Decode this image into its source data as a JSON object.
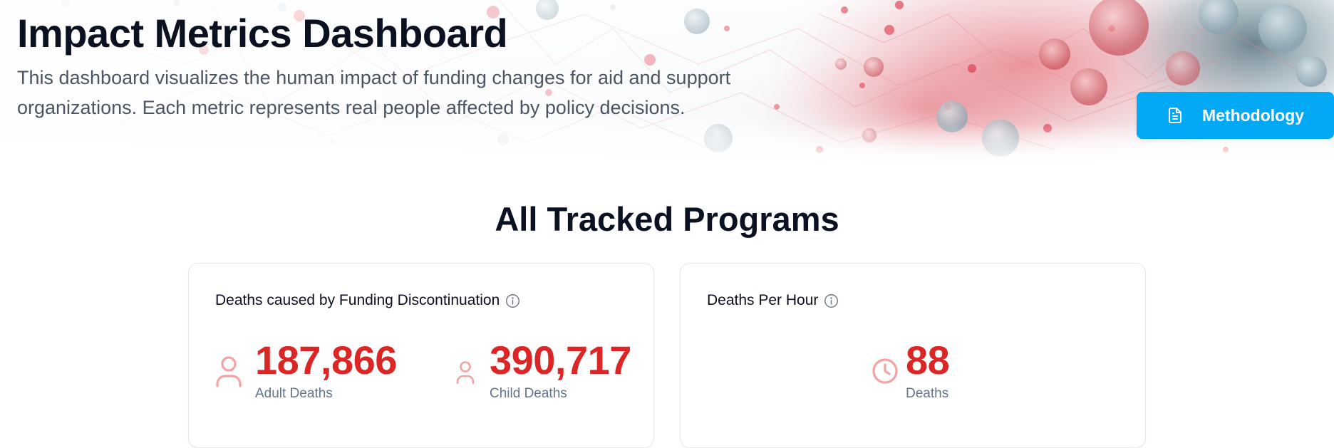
{
  "header": {
    "title": "Impact Metrics Dashboard",
    "description": "This dashboard visualizes the human impact of funding changes for aid and support organizations. Each metric represents real people affected by policy decisions.",
    "methodology_button": {
      "label": "Methodology",
      "icon": "document-icon"
    }
  },
  "section": {
    "title": "All Tracked Programs"
  },
  "cards": [
    {
      "title": "Deaths caused by Funding Discontinuation",
      "info_icon": "info-icon",
      "metrics": [
        {
          "value": "187,866",
          "label": "Adult Deaths",
          "icon": "person-icon"
        },
        {
          "value": "390,717",
          "label": "Child Deaths",
          "icon": "person-icon"
        }
      ]
    },
    {
      "title": "Deaths Per Hour",
      "info_icon": "info-icon",
      "metrics": [
        {
          "value": "88",
          "label": "Deaths",
          "icon": "clock-icon"
        }
      ]
    }
  ],
  "colors": {
    "accent": "#03a9f4",
    "metric_red": "#dc2626",
    "icon_pink": "#f4a3a3",
    "heading": "#0b1120",
    "muted": "#64748b"
  }
}
